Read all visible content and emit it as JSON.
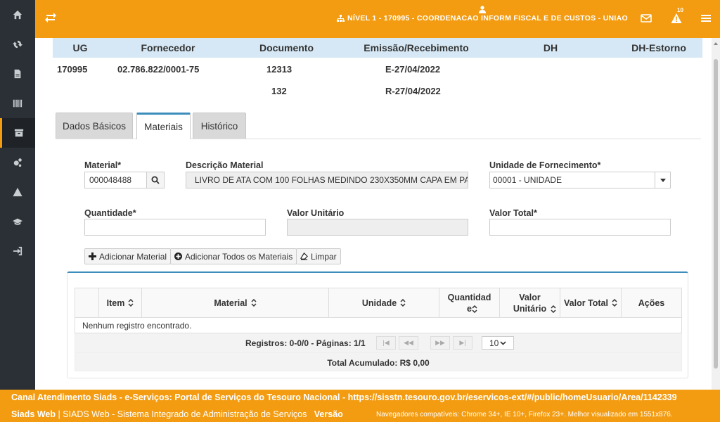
{
  "topbar": {
    "title": "NÍVEL 1 - 170995 - COORDENACAO INFORM FISCAL E DE CUSTOS - UNIAO",
    "notification_count": "10"
  },
  "sidebar": {
    "items": [
      {
        "icon": "home-icon"
      },
      {
        "icon": "refresh-icon"
      },
      {
        "icon": "document-icon"
      },
      {
        "icon": "barcode-icon"
      },
      {
        "icon": "archive-icon",
        "active": true
      },
      {
        "icon": "gears-icon"
      },
      {
        "icon": "warning-icon"
      },
      {
        "icon": "graduation-cap-icon"
      },
      {
        "icon": "sign-in-icon"
      }
    ]
  },
  "doc_header": {
    "columns": [
      "UG",
      "Fornecedor",
      "Documento",
      "Emissão/Recebimento",
      "DH",
      "DH-Estorno"
    ],
    "ug": "170995",
    "fornecedor": "02.786.822/0001-75",
    "documento_1": "12313",
    "documento_2": "132",
    "emissao": "E-27/04/2022",
    "recebimento": "R-27/04/2022"
  },
  "tabs": [
    {
      "label": "Dados Básicos"
    },
    {
      "label": "Materiais",
      "active": true
    },
    {
      "label": "Histórico"
    }
  ],
  "form": {
    "material_label": "Material*",
    "material_value": "000048488",
    "descricao_label": "Descrição Material",
    "descricao_value": "LIVRO DE ATA COM 100 FOLHAS MEDINDO 230X350MM CAPA EM PA",
    "unidade_label": "Unidade de Fornecimento*",
    "unidade_value": "00001 - UNIDADE",
    "quantidade_label": "Quantidade*",
    "quantidade_value": "",
    "valor_unitario_label": "Valor Unitário",
    "valor_unitario_value": "",
    "valor_total_label": "Valor Total*",
    "valor_total_value": ""
  },
  "buttons": {
    "add": "Adicionar Material",
    "add_all": "Adicionar Todos os Materiais",
    "clear": "Limpar"
  },
  "table": {
    "columns": [
      "Item",
      "Material",
      "Unidade",
      "Quantidade",
      "Valor Unitário",
      "Valor Total",
      "Ações"
    ],
    "empty": "Nenhum registro encontrado.",
    "pager_text": "Registros: 0-0/0 - Páginas: 1/1",
    "page_size": "10",
    "total": "Total Acumulado: R$ 0,00"
  },
  "footer": {
    "line1": "Canal Atendimento Siads - e-Serviços: Portal de Serviços do Tesouro Nacional - https://sisstn.tesouro.gov.br/eservicos-ext/#/public/homeUsuario/Area/1142339",
    "app_name": "Siads Web",
    "app_desc": "| SIADS Web - Sistema Integrado de Administração de Serviços",
    "version_label": "Versão",
    "browsers": "Navegadores compatíveis: Chrome 34+, IE 10+, Firefox 23+. Melhor visualizado em 1551x876."
  },
  "colors": {
    "accent": "#f39c12",
    "sidebar": "#2a3035",
    "highlight": "#3c8dbc",
    "header_bg": "#d6e8f5"
  }
}
